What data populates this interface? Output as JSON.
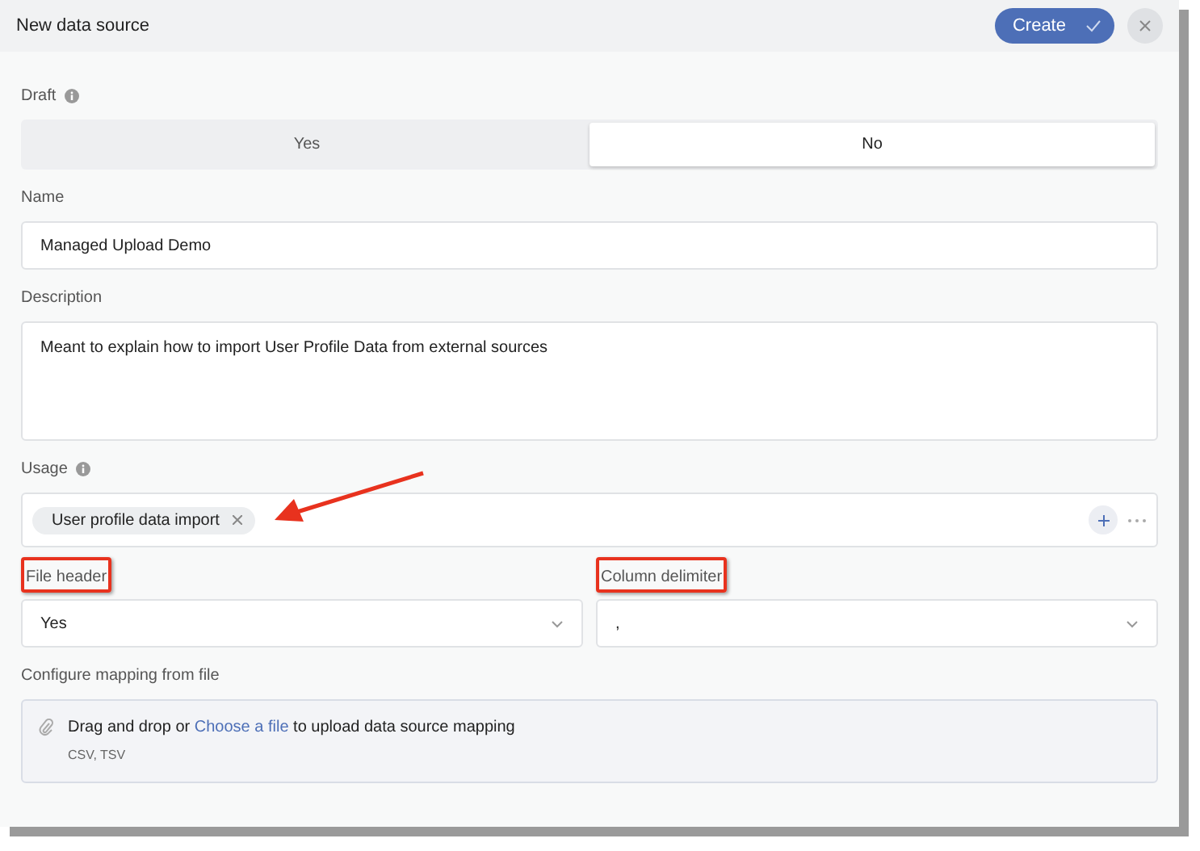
{
  "header": {
    "title": "New data source",
    "create_button": "Create"
  },
  "draft": {
    "label": "Draft",
    "options": [
      {
        "label": "Yes",
        "selected": false
      },
      {
        "label": "No",
        "selected": true
      }
    ]
  },
  "name": {
    "label": "Name",
    "value": "Managed Upload Demo"
  },
  "description": {
    "label": "Description",
    "value": "Meant to explain how to import User Profile Data from external sources"
  },
  "usage": {
    "label": "Usage",
    "tags": [
      "User profile data import"
    ],
    "arrow_annotation": true
  },
  "selects": [
    {
      "label": "File header",
      "value": "Yes",
      "highlighted": true
    },
    {
      "label": "Column delimiter",
      "value": ",",
      "highlighted": true
    }
  ],
  "mapping": {
    "label": "Configure mapping from file",
    "text_before": "Drag and drop or",
    "link": "Choose a file",
    "text_after": "to upload data source mapping",
    "formats": "CSV, TSV"
  }
}
